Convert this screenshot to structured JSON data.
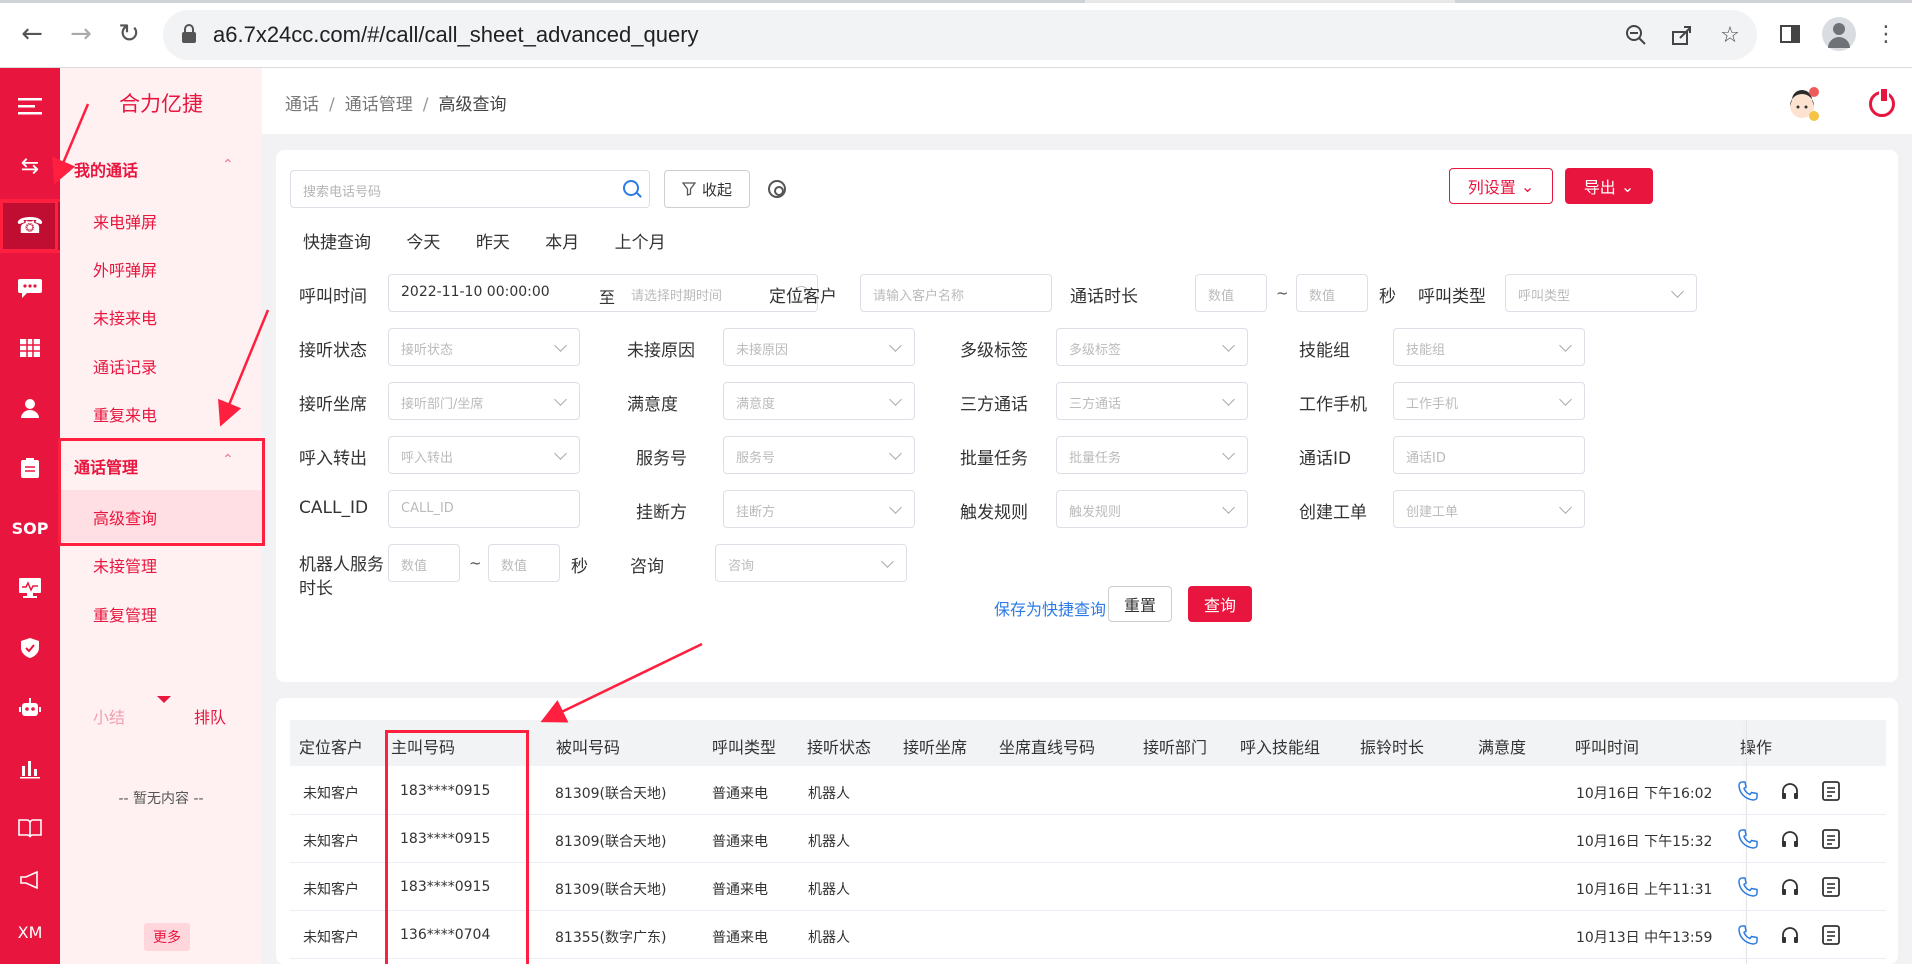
{
  "browser": {
    "url": "a6.7x24cc.com/#/call/call_sheet_advanced_query"
  },
  "sidebar": {
    "brand": "合力亿捷",
    "group1": {
      "label": "我的通话",
      "items": [
        "来电弹屏",
        "外呼弹屏",
        "未接来电",
        "通话记录",
        "重复来电"
      ]
    },
    "group2": {
      "label": "通话管理",
      "items": [
        "高级查询",
        "未接管理",
        "重复管理"
      ]
    },
    "tabs": [
      "小结",
      "排队"
    ],
    "empty": "-- 暂无内容 --",
    "more": "更多",
    "rail_labels": {
      "sop": "SOP",
      "xm": "XM"
    }
  },
  "breadcrumb": [
    "通话",
    "通话管理",
    "高级查询"
  ],
  "filter": {
    "search_placeholder": "搜索电话号码",
    "collapse_label": "收起",
    "column_settings_label": "列设置",
    "export_label": "导出",
    "quick": {
      "label": "快捷查询",
      "options": [
        "今天",
        "昨天",
        "本月",
        "上个月"
      ]
    },
    "rows": {
      "call_time": {
        "label": "呼叫时间",
        "start": "2022-11-10 00:00:00",
        "sep": "至",
        "end_placeholder": "请选择时期时间"
      },
      "locate_customer": {
        "label": "定位客户",
        "placeholder": "请输入客户名称"
      },
      "duration": {
        "label": "通话时长",
        "min_placeholder": "数值",
        "max_placeholder": "数值",
        "unit": "秒"
      },
      "call_type": {
        "label": "呼叫类型",
        "placeholder": "呼叫类型"
      },
      "answer_status": {
        "label": "接听状态",
        "placeholder": "接听状态"
      },
      "missed_reason": {
        "label": "未接原因",
        "placeholder": "未接原因"
      },
      "multi_tag": {
        "label": "多级标签",
        "placeholder": "多级标签"
      },
      "skill_group": {
        "label": "技能组",
        "placeholder": "技能组"
      },
      "answer_seat": {
        "label": "接听坐席",
        "placeholder": "接听部门/坐席"
      },
      "satisfaction": {
        "label": "满意度",
        "placeholder": "满意度"
      },
      "three_way": {
        "label": "三方通话",
        "placeholder": "三方通话"
      },
      "work_phone": {
        "label": "工作手机",
        "placeholder": "工作手机"
      },
      "transfer": {
        "label": "呼入转出",
        "placeholder": "呼入转出"
      },
      "service_no": {
        "label": "服务号",
        "placeholder": "服务号"
      },
      "batch_task": {
        "label": "批量任务",
        "placeholder": "批量任务"
      },
      "call_id_cn": {
        "label": "通话ID",
        "placeholder": "通话ID"
      },
      "call_id": {
        "label": "CALL_ID",
        "placeholder": "CALL_ID"
      },
      "hangup": {
        "label": "挂断方",
        "placeholder": "挂断方"
      },
      "trigger": {
        "label": "触发规则",
        "placeholder": "触发规则"
      },
      "ticket": {
        "label": "创建工单",
        "placeholder": "创建工单"
      },
      "robot_duration": {
        "label1": "机器人服务",
        "label2": "时长",
        "min_placeholder": "数值",
        "max_placeholder": "数值",
        "unit": "秒"
      },
      "consult": {
        "label": "咨询",
        "placeholder": "咨询"
      }
    },
    "tilde": "~",
    "save_quick": "保存为快捷查询",
    "reset": "重置",
    "query": "查询"
  },
  "table": {
    "headers": [
      "定位客户",
      "主叫号码",
      "被叫号码",
      "呼叫类型",
      "接听状态",
      "接听坐席",
      "坐席直线号码",
      "接听部门",
      "呼入技能组",
      "振铃时长",
      "满意度",
      "呼叫时间",
      "操作"
    ],
    "rows": [
      {
        "customer": "未知客户",
        "caller": "183****0915",
        "callee": "81309(联合天地)",
        "type": "普通来电",
        "status": "机器人",
        "time": "10月16日 下午16:02"
      },
      {
        "customer": "未知客户",
        "caller": "183****0915",
        "callee": "81309(联合天地)",
        "type": "普通来电",
        "status": "机器人",
        "time": "10月16日 下午15:32"
      },
      {
        "customer": "未知客户",
        "caller": "183****0915",
        "callee": "81309(联合天地)",
        "type": "普通来电",
        "status": "机器人",
        "time": "10月16日 上午11:31"
      },
      {
        "customer": "未知客户",
        "caller": "136****0704",
        "callee": "81355(数字广东)",
        "type": "普通来电",
        "status": "机器人",
        "time": "10月13日 中午13:59"
      }
    ]
  },
  "colors": {
    "brand": "#e8163f",
    "link": "#2d7be5"
  }
}
